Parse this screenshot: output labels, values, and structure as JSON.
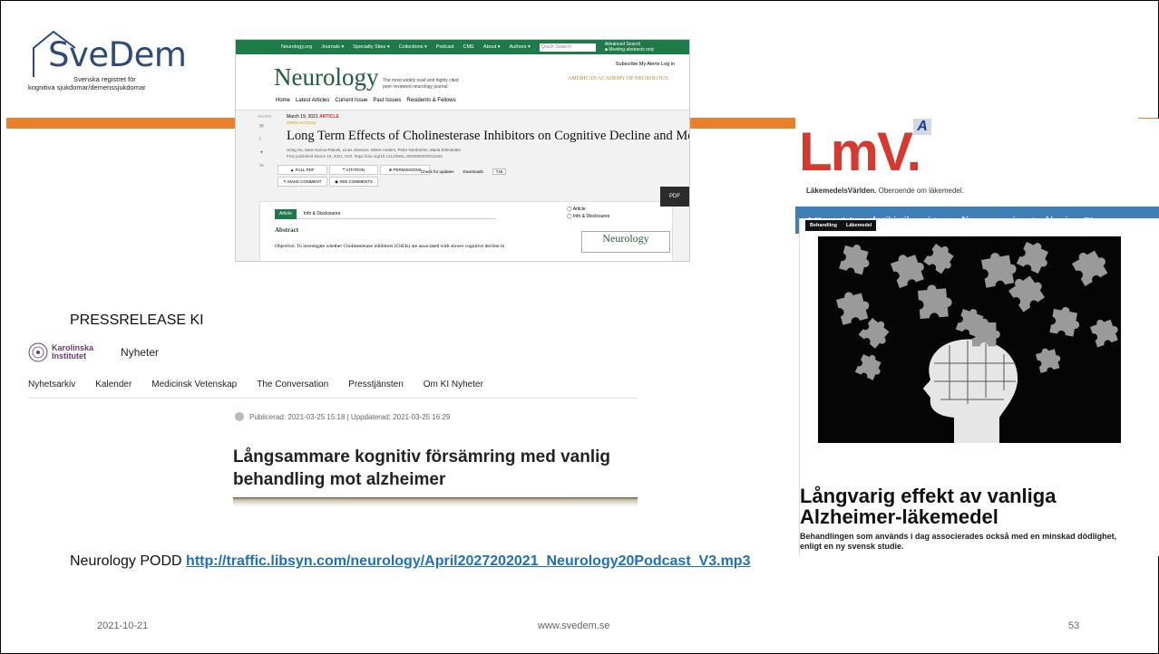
{
  "logo": {
    "word": "SveDem",
    "sub1": "Svenska registret för",
    "sub2": "kognitiva sjukdomar/demenssjukdomar"
  },
  "colors": {
    "accent": "#e8802c",
    "neurology_green": "#1f7a4a",
    "lmv_red": "#d63a2f",
    "lmv_blue": "#3d7fb6",
    "link": "#1f6fbf"
  },
  "neurology": {
    "topnav": [
      "Neurology.org",
      "Journals ▾",
      "Specialty Sites ▾",
      "Collections ▾",
      "Podcast",
      "CME",
      "About ▾",
      "Authors ▾"
    ],
    "search_placeholder": "Quick Search",
    "advanced": "Advanced Search",
    "meeting_only": "Meeting abstracts only",
    "logo": "Neurology",
    "tagline": "The most widely read and highly cited peer-reviewed neurology journal",
    "account": "Subscribe  My Alerts  Log in",
    "aan": "AMERICAN ACADEMY OF NEUROLOGY.",
    "nav": [
      "Home",
      "Latest Articles",
      "Current Issue",
      "Past Issues",
      "Residents & Fellows"
    ],
    "share": "SHARE",
    "date": "March 19, 2021",
    "article_label": "ARTICLE",
    "open_access": "OPEN ACCESS",
    "title": "Long Term Effects of Cholinesterase Inhibitors on Cognitive Decline and Mortality",
    "authors": "Hong Xu, Sara Garcia-Ptacek, Linus Jönsson, Mimis Anders, Peter Nordström, Maria Eriksdotter",
    "published": "First published March 19, 2021, DOI: https://doi.org/10.1212/WNL.0000000000011832",
    "buttons": [
      "▲ FULL PDF",
      "❝ CITATION",
      "⊕ PERMISSIONS",
      "✎ MAKE COMMENT",
      "◉ SEE COMMENTS"
    ],
    "check_updates": "Check for updates",
    "downloads": "Downloads",
    "downloads_count": "746",
    "tab_article": "Article",
    "tab_info": "Info & Disclosures",
    "side_article": "Article",
    "side_info": "Info & Disclosures",
    "abstract": "Abstract",
    "objective": "Objective: To investigate whether Cholinesterase inhibitors (ChEIs) are associated with slower cognitive decline in",
    "podcast_logo": "Neurology",
    "pdf": "PDF"
  },
  "lmv": {
    "logo": "LmV.",
    "badge": "A",
    "sub_bold": "LäkemedelsVärlden.",
    "sub_rest": " Oberoende om läkemedel.",
    "nav": [
      "Läkemedel ▾",
      "Antibiotikaresistens",
      "Nya coronaviruset",
      "Vaccin",
      "Bloggar ▾"
    ],
    "tags": [
      "Behandling",
      "Läkemedel"
    ],
    "title_line1": "Långvarig effekt av vanliga",
    "title_line2": "Alzheimer-läkemedel",
    "lead": "Behandlingen som används i dag associerades också med en minskad dödlighet, enligt en ny svensk studie."
  },
  "press": {
    "label": "PRESSRELEASE KI",
    "ki_line1": "Karolinska",
    "ki_line2": "Institutet",
    "nyheter": "Nyheter",
    "nav": [
      "Nyhetsarkiv",
      "Kalender",
      "Medicinsk Vetenskap",
      "The Conversation",
      "Presstjänsten",
      "Om KI Nyheter"
    ],
    "published": "Publicerad: 2021-03-25 15:18 | Uppdaterad: 2021-03-25 16:29",
    "title": "Långsammare kognitiv försämring med vanlig behandling mot alzheimer"
  },
  "podd": {
    "label": "Neurology PODD ",
    "url": "http://traffic.libsyn.com/neurology/April2027202021_Neurology20Podcast_V3.mp3"
  },
  "footer": {
    "date": "2021-10-21",
    "site": "www.svedem.se",
    "page": "53"
  }
}
